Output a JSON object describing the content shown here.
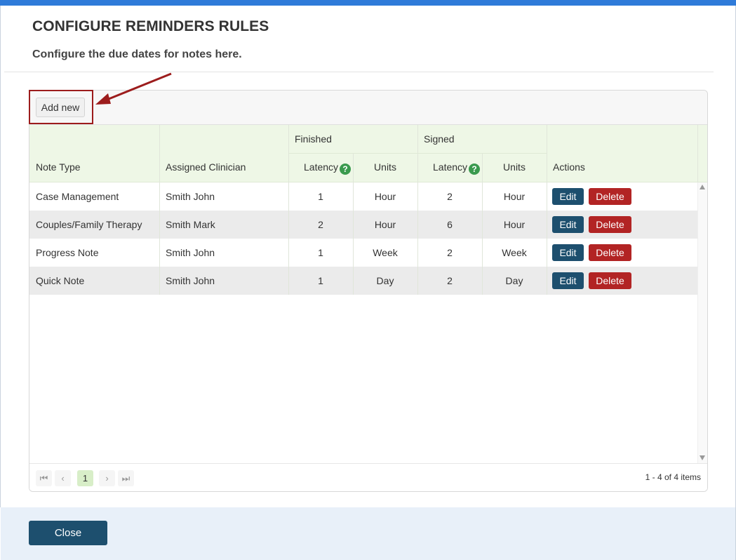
{
  "header": {
    "title": "CONFIGURE REMINDERS RULES",
    "subtitle": "Configure the due dates for notes here."
  },
  "toolbar": {
    "add_new_label": "Add new"
  },
  "columns": {
    "note_type": "Note Type",
    "assigned_clinician": "Assigned Clinician",
    "finished_group": "Finished",
    "signed_group": "Signed",
    "latency": "Latency",
    "units": "Units",
    "actions": "Actions",
    "help_glyph": "?"
  },
  "rows": [
    {
      "note_type": "Case Management",
      "clinician": "Smith John",
      "finished_latency": "1",
      "finished_units": "Hour",
      "signed_latency": "2",
      "signed_units": "Hour"
    },
    {
      "note_type": "Couples/Family Therapy",
      "clinician": "Smith Mark",
      "finished_latency": "2",
      "finished_units": "Hour",
      "signed_latency": "6",
      "signed_units": "Hour"
    },
    {
      "note_type": "Progress Note",
      "clinician": "Smith John",
      "finished_latency": "1",
      "finished_units": "Week",
      "signed_latency": "2",
      "signed_units": "Week"
    },
    {
      "note_type": "Quick Note",
      "clinician": "Smith John",
      "finished_latency": "1",
      "finished_units": "Day",
      "signed_latency": "2",
      "signed_units": "Day"
    }
  ],
  "actions": {
    "edit_label": "Edit",
    "delete_label": "Delete"
  },
  "pager": {
    "first": "⏮",
    "prev": "‹",
    "current_page": "1",
    "next": "›",
    "last": "⏭",
    "info": "1 - 4 of 4 items"
  },
  "footer": {
    "close_label": "Close"
  },
  "colors": {
    "accent": "#2f7bd9",
    "primary_button": "#1d4f6e",
    "danger_button": "#b22424",
    "header_bg": "#eef7e6",
    "help_icon": "#3a9a4e",
    "annotation": "#9c1c1c"
  }
}
